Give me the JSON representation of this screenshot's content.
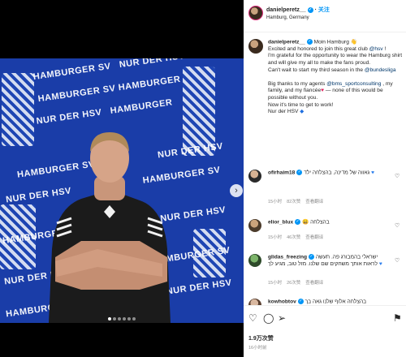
{
  "post": {
    "username": "danielperetz__",
    "follow_label": "关注",
    "location": "Hamburg, Germany"
  },
  "caption": {
    "username": "danielperetz__",
    "line1_a": "Moin Hamburg",
    "line2_a": "Excited and honored to join this great club ",
    "line2_mention": "@hsv",
    "line2_b": " !",
    "line3": "I'm grateful for the opportunity to wear the Hamburg shirt and will give my all to make the fans proud.",
    "line4_a": "Can't wait to start my third season in the ",
    "line4_tag": "@bundesliga",
    "line5_a": "Big thanks to my agents ",
    "line5_mention": "@bms_sportconsulting",
    "line5_b": " , my family, and my fiancée",
    "line5_c": " — none of this would be possible without you.",
    "line6": "Now it's time to get to work!",
    "line7": "Nur der HSV"
  },
  "comments": [
    {
      "username": "ofirhaim18",
      "text": "גאווה של מדינה, בהצלחה ילד",
      "time": "15小时",
      "likes": "82次赞",
      "reply": "查看翻译"
    },
    {
      "username": "elior_blux",
      "text": "בהצלחה",
      "time": "15小时",
      "likes": "46次赞",
      "reply": "查看翻译"
    },
    {
      "username": "glidas_freezing",
      "text": "ישראלי בהמבורג פה. תעשה לראות אותך משחקים שם שלנו. מזל טוב, מגיע לך",
      "time": "15小时",
      "likes": "26次赞",
      "reply": "查看翻译"
    },
    {
      "username": "kowhobtov",
      "text": "בהצלחה אלוף שלנו גאה בך",
      "time": "",
      "likes": "",
      "reply": ""
    }
  ],
  "actions": {
    "likes": "1.9万次赞",
    "time": "16小时前"
  },
  "colors": {
    "accent": "#0095f6",
    "mention": "#00376b",
    "photo_bg": "#1a3da8"
  }
}
